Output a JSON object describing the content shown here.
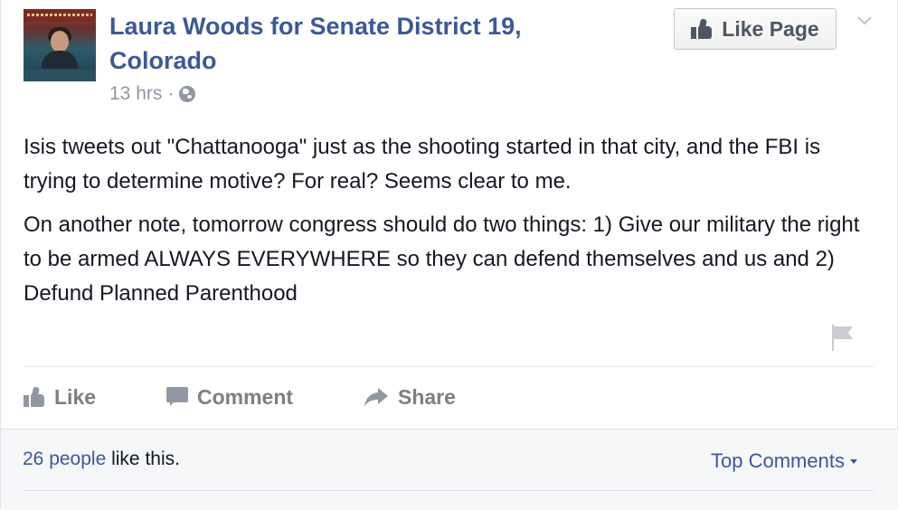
{
  "post": {
    "page_name": "Laura Woods for Senate District 19, Colorado",
    "time": "13 hrs",
    "separator": "·",
    "audience_icon": "globe-icon",
    "like_page_label": "Like Page",
    "paragraphs": [
      "Isis tweets out \"Chattanooga\" just as the shooting started in that city, and the FBI is trying to determine motive? For real? Seems clear to me.",
      "On another note, tomorrow congress should do two things: 1) Give our military the right to be armed ALWAYS EVERYWHERE so they can defend themselves and us and 2) Defund Planned Parenthood"
    ]
  },
  "actions": {
    "like": "Like",
    "comment": "Comment",
    "share": "Share"
  },
  "footer": {
    "people_count": "26 people",
    "likes_suffix": " like this.",
    "top_comments": "Top Comments"
  },
  "colors": {
    "link": "#3b5998",
    "muted": "#9197a3",
    "text": "#141823"
  }
}
